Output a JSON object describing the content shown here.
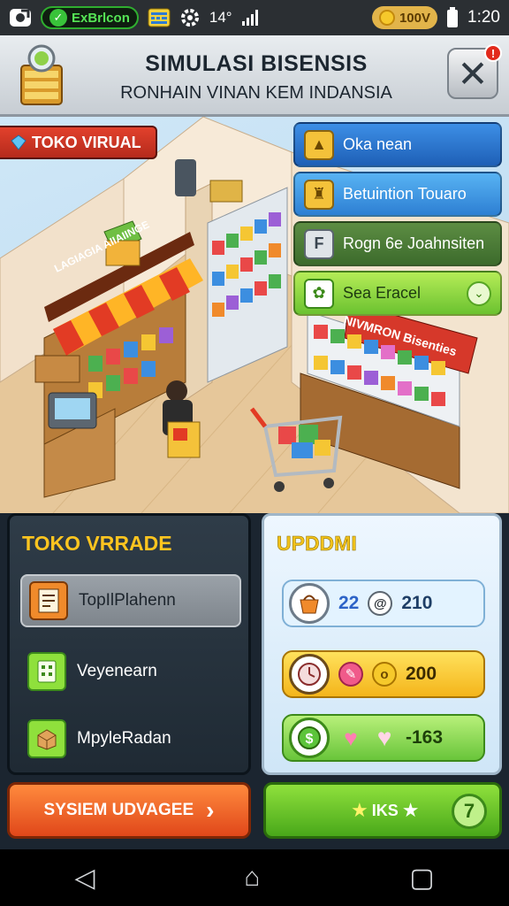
{
  "status_bar": {
    "app_label": "ExBrlcon",
    "temp": "14°",
    "coin_amount": "100V",
    "time": "1:20"
  },
  "header": {
    "title": "SIMULASI BISENSIS",
    "subtitle": "RONHAIN VINAN KEM INDANSIA",
    "close_symbol": "✕",
    "notification_count": "!"
  },
  "scene": {
    "store_tag": "TOKO VIRUAL",
    "shop_sign": "LAGIAGIA AIIAIINGE",
    "shelf_sign": "NIVMRON Bisenties",
    "menu": [
      {
        "label": "Oka nean"
      },
      {
        "label": "Betuintion Touaro"
      },
      {
        "label": "Rogn 6e Joahnsiten"
      },
      {
        "label": "Sea Eracel"
      }
    ]
  },
  "left_panel": {
    "title": "TOKO VRRADE",
    "items": [
      {
        "label": "TopIlPlahenn"
      },
      {
        "label": "Veyenearn"
      },
      {
        "label": "MpyleRadan"
      }
    ]
  },
  "right_panel": {
    "title": "UPDDMI",
    "stats": [
      {
        "value_a": "22",
        "value_b": "210"
      },
      {
        "value_b": "200"
      },
      {
        "value_b": "-163"
      }
    ]
  },
  "buttons": {
    "upgrade_label": "SYSIEM UDVAGEE",
    "go_label": "IKS",
    "go_badge": "7"
  },
  "colors": {
    "accent_orange": "#e0471a",
    "accent_green": "#49a81a",
    "panel_dark": "#1f2a34",
    "title_yellow": "#ffc51f"
  }
}
